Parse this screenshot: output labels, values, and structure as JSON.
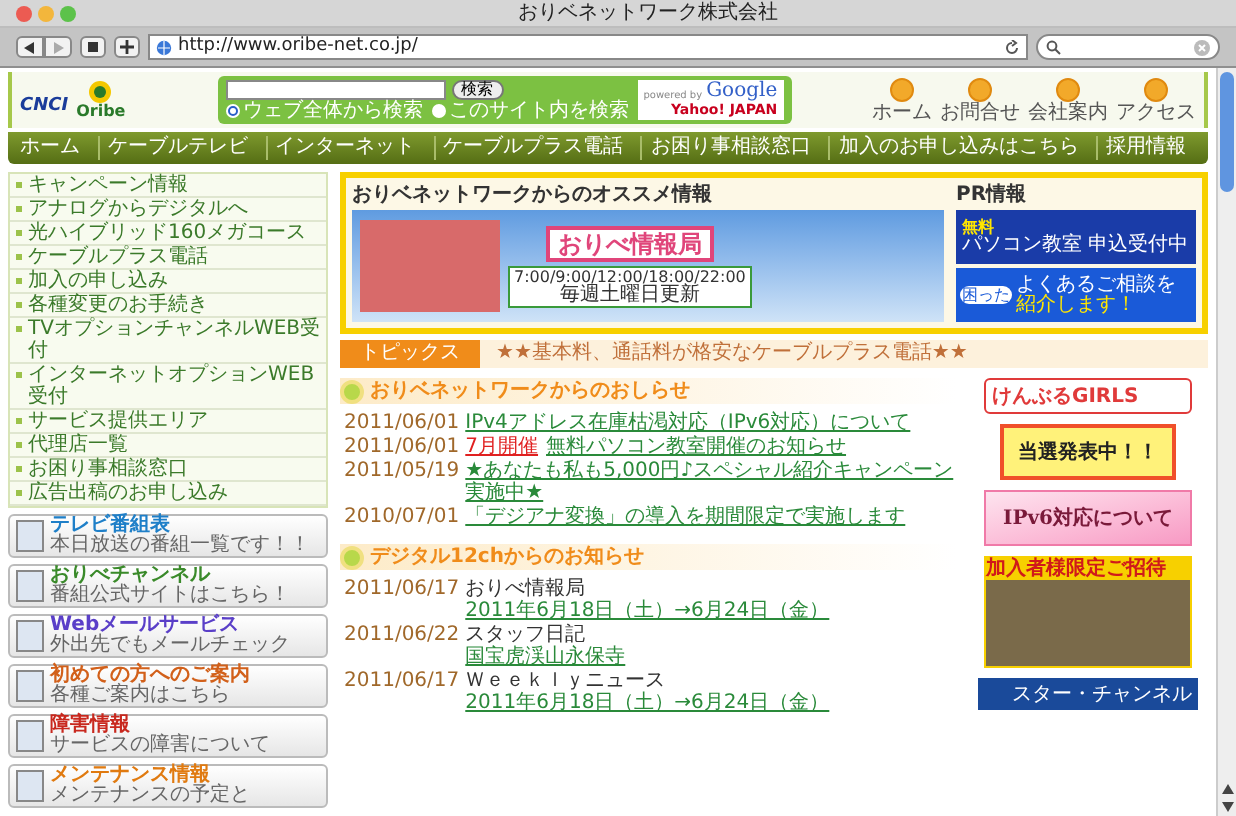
{
  "window": {
    "title": "おりベネットワーク株式会社"
  },
  "toolbar": {
    "url": "http://www.oribe-net.co.jp/"
  },
  "logo": {
    "brand": "CNCI",
    "name": "Oribe"
  },
  "search": {
    "button": "検索",
    "powered_by": "powered by",
    "google": "Google",
    "yahoo": "Yahoo! JAPAN",
    "options": [
      {
        "label": "ウェブ全体から検索",
        "selected": true
      },
      {
        "label": "このサイト内を検索",
        "selected": false
      }
    ]
  },
  "header_links": [
    "ホーム",
    "お問合せ",
    "会社案内",
    "アクセス"
  ],
  "nav": [
    "ホーム",
    "ケーブルテレビ",
    "インターネット",
    "ケーブルプラス電話",
    "お困り事相談窓口",
    "加入のお申し込みはこちら",
    "採用情報"
  ],
  "sidebar": {
    "items": [
      "キャンペーン情報",
      "アナログからデジタルへ",
      "光ハイブリッド160メガコース",
      "ケーブルプラス電話",
      "加入の申し込み",
      "各種変更のお手続き",
      "TVオプションチャンネルWEB受付",
      "インターネットオプションWEB受付",
      "サービス提供エリア",
      "代理店一覧",
      "お困り事相談窓口",
      "広告出稿のお申し込み"
    ],
    "banners": [
      {
        "title": "テレビ番組表",
        "subtitle": "本日放送の番組一覧です！！",
        "color": "#1e7fc8"
      },
      {
        "title": "おりべチャンネル",
        "subtitle": "番組公式サイトはこちら！",
        "color": "#3a8a2a"
      },
      {
        "title": "Webメールサービス",
        "subtitle": "外出先でもメールチェック",
        "color": "#5a3fc8"
      },
      {
        "title": "初めての方へのご案内",
        "subtitle": "各種ご案内はこちら",
        "color": "#d2601a"
      },
      {
        "title": "障害情報",
        "subtitle": "サービスの障害について",
        "color": "#c8281e"
      },
      {
        "title": "メンテナンス情報",
        "subtitle": "メンテナンスの予定と",
        "color": "#e07a10"
      }
    ]
  },
  "featured": {
    "title": "おりベネットワークからのオススメ情報",
    "banner": {
      "title": "おりべ情報局",
      "times": "7:00/9:00/12:00/18:00/22:00",
      "note": "毎週土曜日更新"
    },
    "pr_title": "PR情報",
    "pr_banners": [
      {
        "kind": "pc",
        "lines": [
          "無料",
          "パソコン教室",
          "申込受付中"
        ]
      },
      {
        "kind": "advice",
        "lines": [
          "困った",
          "よくあるご相談を",
          "紹介します！"
        ]
      }
    ]
  },
  "topics": {
    "label": "トピックス",
    "ticker": "★★基本料、通話料が格安なケーブルプラス電話★★"
  },
  "news": [
    {
      "heading": "おりベネットワークからのおしらせ",
      "items": [
        {
          "date": "2011/06/01",
          "link": "IPv4アドレス在庫枯渇対応（IPv6対応）について"
        },
        {
          "date": "2011/06/01",
          "tag": "7月開催",
          "link": "無料パソコン教室開催のお知らせ"
        },
        {
          "date": "2011/05/19",
          "link": "★あなたも私も5,000円♪スペシャル紹介キャンペーン実施中★"
        },
        {
          "date": "2010/07/01",
          "link": "「デジアナ変換」の導入を期間限定で実施します"
        }
      ]
    },
    {
      "heading": "デジタル12chからのお知らせ",
      "items": [
        {
          "date": "2011/06/17",
          "title": "おりべ情報局",
          "link": "2011年6月18日（土）→6月24日（金）"
        },
        {
          "date": "2011/06/22",
          "title": "スタッフ日記",
          "link": "国宝虎渓山永保寺"
        },
        {
          "date": "2011/06/17",
          "title": "Ｗｅｅｋｌｙニュース",
          "link": "2011年6月18日（土）→6月24日（金）"
        }
      ]
    }
  ],
  "right_banners": [
    {
      "kind": "girls",
      "text": "けんぶるGIRLS"
    },
    {
      "kind": "ribbon",
      "text": "当選発表中！！"
    },
    {
      "kind": "pink",
      "text": "IPv6対応について"
    },
    {
      "kind": "movie",
      "text": "加入者様限定ご招待"
    },
    {
      "kind": "channel",
      "text": "スター・チャンネル"
    }
  ]
}
